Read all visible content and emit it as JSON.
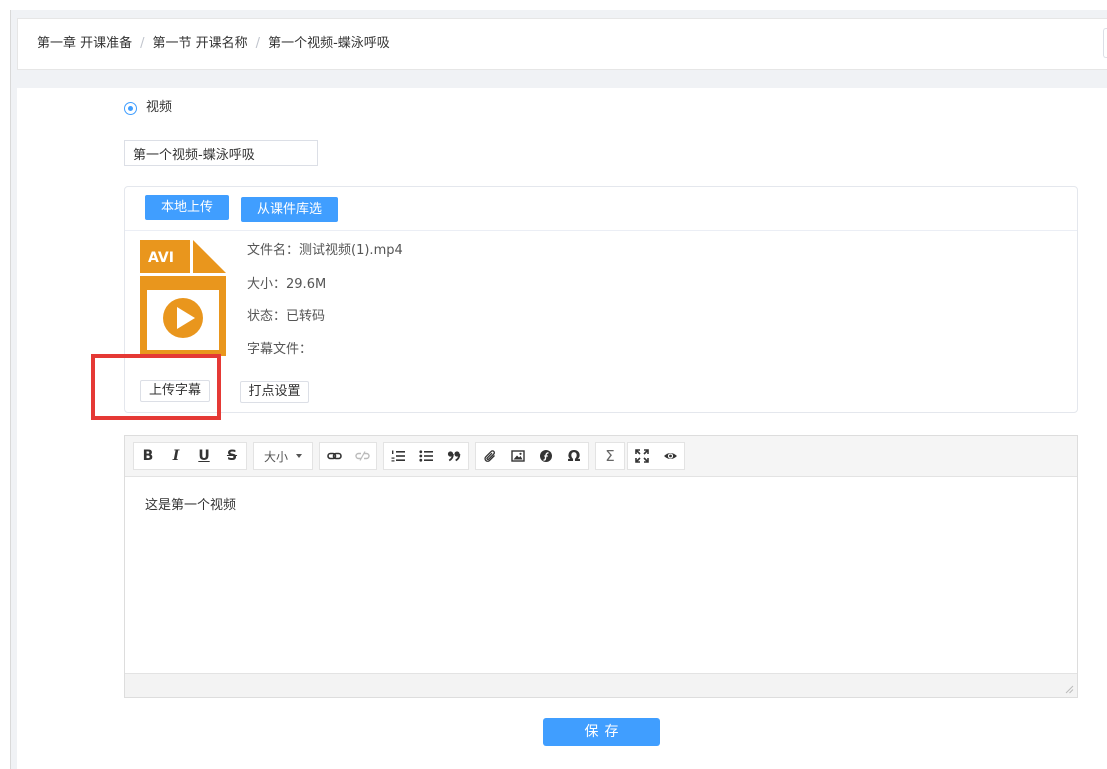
{
  "colors": {
    "accent": "#409eff",
    "highlight": "#e53935",
    "file_icon": "#e9961d"
  },
  "breadcrumb": {
    "separator": "/",
    "items": [
      "第一章 开课准备",
      "第一节 开课名称",
      "第一个视频-蝶泳呼吸"
    ]
  },
  "content_type": {
    "label": "视频",
    "selected": true
  },
  "title_input": {
    "value": "第一个视频-蝶泳呼吸"
  },
  "upload": {
    "local_upload_label": "本地上传",
    "library_select_label": "从课件库选",
    "file": {
      "icon": "avi-file-icon",
      "icon_label": "AVI",
      "name_label": "文件名：",
      "name": "测试视频(1).mp4",
      "size_label": "大小：",
      "size": "29.6M",
      "status_label": "状态：",
      "status": "已转码",
      "subtitle_label": "字幕文件："
    },
    "upload_subtitle_label": "上传字幕",
    "marker_settings_label": "打点设置"
  },
  "editor": {
    "toolbar": {
      "bold": "B",
      "italic": "I",
      "underline": "U",
      "strikethrough": "S",
      "font_size": "大小",
      "special_char": "Ω",
      "formula": "Σ",
      "icons": [
        "link-icon",
        "unlink-icon",
        "ordered-list-icon",
        "unordered-list-icon",
        "quote-icon",
        "attachment-icon",
        "image-icon",
        "flash-icon",
        "fullscreen-icon",
        "preview-icon",
        "caret-down-icon",
        "resize-handle-icon"
      ]
    },
    "content": "这是第一个视频"
  },
  "save_label": "保存"
}
